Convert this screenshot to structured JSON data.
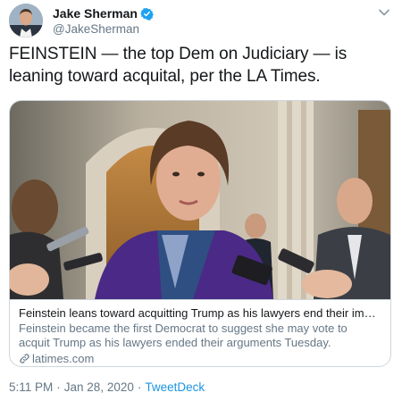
{
  "author": {
    "display_name": "Jake Sherman",
    "handle": "@JakeSherman",
    "verified": true
  },
  "tweet": {
    "text": "FEINSTEIN — the top Dem on Judiciary — is leaning toward acquital, per the LA Times."
  },
  "card": {
    "title": "Feinstein leans toward acquitting Trump as his lawyers end their impeachme...",
    "description": "Feinstein became the first Democrat to suggest she may vote to acquit Trump as his lawyers ended their arguments Tuesday. Republicans are divided on ...",
    "domain": "latimes.com"
  },
  "meta": {
    "time": "5:11 PM",
    "separator": "·",
    "date": "Jan 28, 2020",
    "source": "TweetDeck"
  },
  "colors": {
    "link": "#1b95e0",
    "verified": "#1da1f2",
    "secondary_text": "#657786",
    "border": "#ccd6dd"
  },
  "icons": {
    "verified": "verified-badge-icon",
    "menu": "chevron-down-icon",
    "link": "link-icon"
  }
}
